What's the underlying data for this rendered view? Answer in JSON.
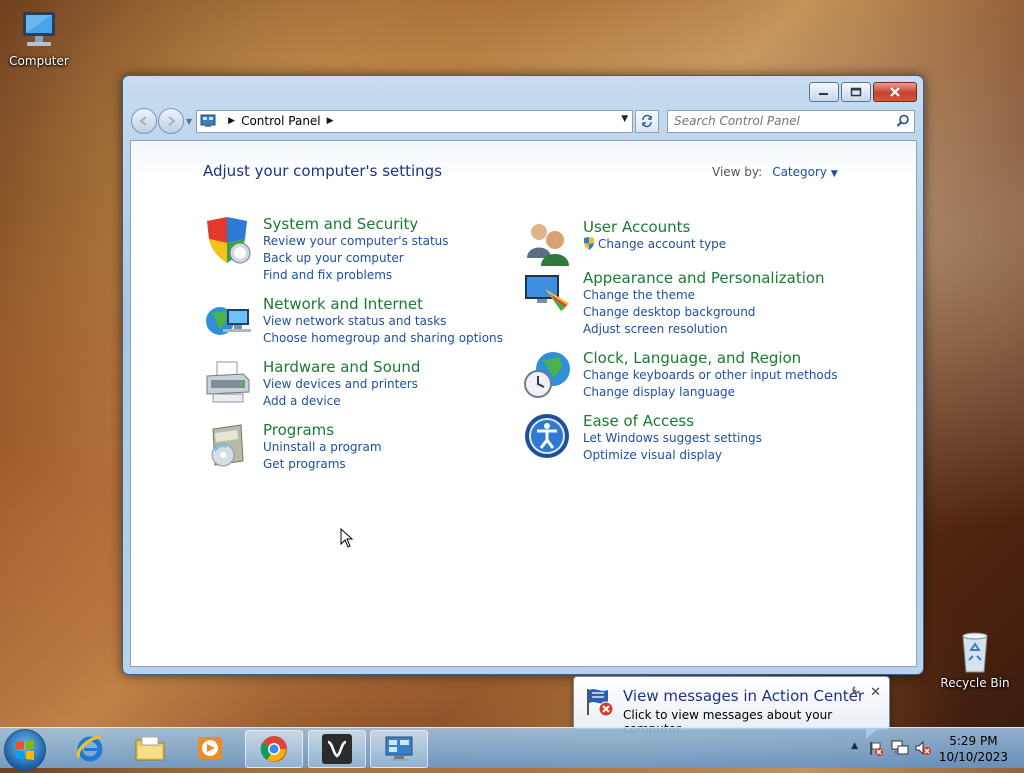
{
  "desktop": {
    "icons": [
      {
        "label": "Computer"
      },
      {
        "label": "Recycle Bin"
      }
    ]
  },
  "window": {
    "address": {
      "breadcrumb": [
        "Control Panel"
      ],
      "search_placeholder": "Search Control Panel"
    },
    "heading": "Adjust your computer's settings",
    "view_by": {
      "label": "View by:",
      "value": "Category"
    },
    "categories_left": [
      {
        "title": "System and Security",
        "icon": "shield-icon",
        "links": [
          "Review your computer's status",
          "Back up your computer",
          "Find and fix problems"
        ]
      },
      {
        "title": "Network and Internet",
        "icon": "network-globe-icon",
        "links": [
          "View network status and tasks",
          "Choose homegroup and sharing options"
        ]
      },
      {
        "title": "Hardware and Sound",
        "icon": "printer-icon",
        "links": [
          "View devices and printers",
          "Add a device"
        ]
      },
      {
        "title": "Programs",
        "icon": "programs-icon",
        "links": [
          "Uninstall a program",
          "Get programs"
        ]
      }
    ],
    "categories_right": [
      {
        "title": "User Accounts",
        "icon": "users-icon",
        "links": [
          "Change account type"
        ]
      },
      {
        "title": "Appearance and Personalization",
        "icon": "monitor-palette-icon",
        "links": [
          "Change the theme",
          "Change desktop background",
          "Adjust screen resolution"
        ]
      },
      {
        "title": "Clock, Language, and Region",
        "icon": "globe-clock-icon",
        "links": [
          "Change keyboards or other input methods",
          "Change display language"
        ]
      },
      {
        "title": "Ease of Access",
        "icon": "ease-of-access-icon",
        "links": [
          "Let Windows suggest settings",
          "Optimize visual display"
        ]
      }
    ]
  },
  "notification": {
    "title": "View messages in Action Center",
    "text": "Click to view messages about your computer."
  },
  "taskbar": {
    "pinned": [
      "internet-explorer-icon",
      "file-explorer-icon",
      "media-player-icon",
      "chrome-icon",
      "app-x-icon",
      "control-panel-icon"
    ],
    "clock_time": "5:29 PM",
    "clock_date": "10/10/2023"
  },
  "colors": {
    "link": "#1e50a2",
    "category_title": "#1b7a32",
    "heading": "#1e3287"
  }
}
